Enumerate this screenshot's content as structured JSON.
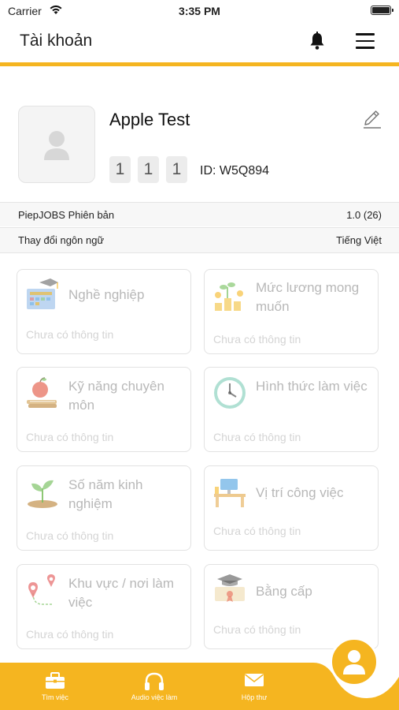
{
  "status_bar": {
    "carrier": "Carrier",
    "time": "3:35 PM"
  },
  "header": {
    "title": "Tài khoản"
  },
  "profile": {
    "name": "Apple Test",
    "digits": [
      "1",
      "1",
      "1"
    ],
    "id_label": "ID: W5Q894"
  },
  "info_rows": [
    {
      "label": "PiepJOBS Phiên bản",
      "value": "1.0 (26)"
    },
    {
      "label": "Thay đổi ngôn ngữ",
      "value": "Tiếng Việt"
    }
  ],
  "cards": [
    {
      "title": "Nghề nghiệp",
      "subtitle": "Chưa có thông tin",
      "icon": "career-icon"
    },
    {
      "title": "Mức lương mong muốn",
      "subtitle": "Chưa có thông tin",
      "icon": "salary-icon"
    },
    {
      "title": "Kỹ năng chuyên môn",
      "subtitle": "Chưa có thông tin",
      "icon": "skills-icon"
    },
    {
      "title": "Hình thức làm việc",
      "subtitle": "Chưa có thông tin",
      "icon": "clock-icon"
    },
    {
      "title": "Số năm kinh nghiệm",
      "subtitle": "Chưa có thông tin",
      "icon": "plant-icon"
    },
    {
      "title": "Vị trí công việc",
      "subtitle": "Chưa có thông tin",
      "icon": "desk-icon"
    },
    {
      "title": "Khu vực / nơi làm việc",
      "subtitle": "Chưa có thông tin",
      "icon": "location-icon"
    },
    {
      "title": "Bằng cấp",
      "subtitle": "Chưa có thông tin",
      "icon": "graduation-icon"
    }
  ],
  "bottom_nav": [
    {
      "label": "Tìm việc",
      "icon": "briefcase-icon"
    },
    {
      "label": "Audio việc làm",
      "icon": "headphones-icon"
    },
    {
      "label": "Hộp thư",
      "icon": "mail-icon"
    }
  ],
  "colors": {
    "accent": "#f5b520",
    "card_border": "#e2e2e2",
    "muted_text": "#b8b8b8"
  }
}
